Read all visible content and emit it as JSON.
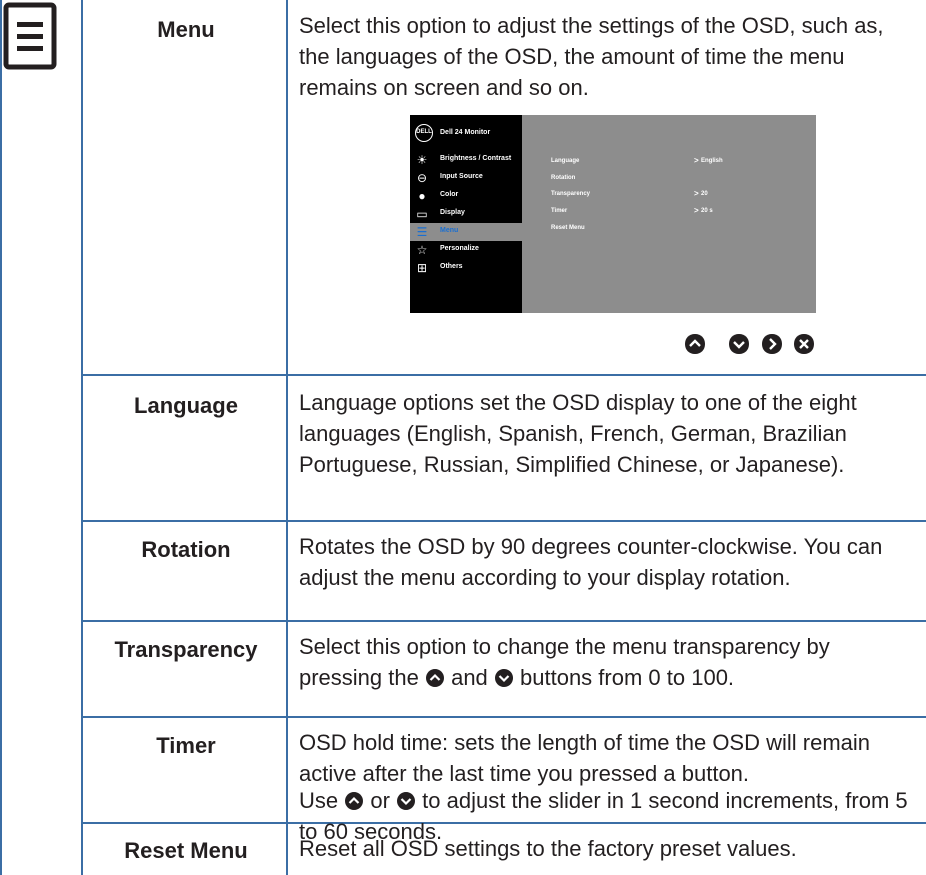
{
  "rows": [
    {
      "label": "Menu",
      "desc": "Select this option to adjust the settings of the OSD, such as, the languages of the OSD, the amount of time the menu remains on screen and so on."
    },
    {
      "label": "Language",
      "desc": "Language options set the OSD display to one of the eight languages (English, Spanish, French, German, Brazilian Portuguese, Russian, Simplified Chinese, or Japanese)."
    },
    {
      "label": "Rotation",
      "desc": "Rotates the OSD by 90 degrees counter-clockwise. You can adjust the menu according to your display rotation."
    },
    {
      "label": "Transparency",
      "desc_before": "Select this option to change the menu transparency by pressing the ",
      "desc_mid": " and ",
      "desc_after": " buttons from 0 to 100."
    },
    {
      "label": "Timer",
      "desc": "OSD hold time: sets the length of time the OSD will remain active after the last time you pressed a button.",
      "desc2_before": "Use ",
      "desc2_mid": " or ",
      "desc2_after": " to adjust the slider in 1 second increments, from 5 to 60 seconds."
    },
    {
      "label": "Reset Menu",
      "desc": "Reset all OSD settings to the factory preset values."
    }
  ],
  "osd": {
    "logo": "DELL",
    "title": "Dell 24 Monitor",
    "menu_items": [
      {
        "icon": "brightness-icon",
        "label": "Brightness / Contrast"
      },
      {
        "icon": "input-source-icon",
        "label": "Input Source"
      },
      {
        "icon": "color-icon",
        "label": "Color"
      },
      {
        "icon": "display-icon",
        "label": "Display"
      },
      {
        "icon": "menu-icon",
        "label": "Menu"
      },
      {
        "icon": "star-icon",
        "label": "Personalize"
      },
      {
        "icon": "others-icon",
        "label": "Others"
      }
    ],
    "selected": "Menu",
    "options": [
      {
        "label": "Language",
        "value": "English"
      },
      {
        "label": "Rotation",
        "value": ""
      },
      {
        "label": "Transparency",
        "value": "20"
      },
      {
        "label": "Timer",
        "value": "20 s"
      },
      {
        "label": "Reset Menu",
        "value": ""
      }
    ]
  },
  "colors": {
    "rule": "#3b6ea5",
    "row_bg": "#e9f1f9",
    "osd_gray": "#8d8d8d",
    "button": "#231f20",
    "osd_selected_text": "#1a6fd1"
  },
  "buttons": [
    "up-button-icon",
    "down-button-icon",
    "right-button-icon",
    "close-button-icon"
  ]
}
